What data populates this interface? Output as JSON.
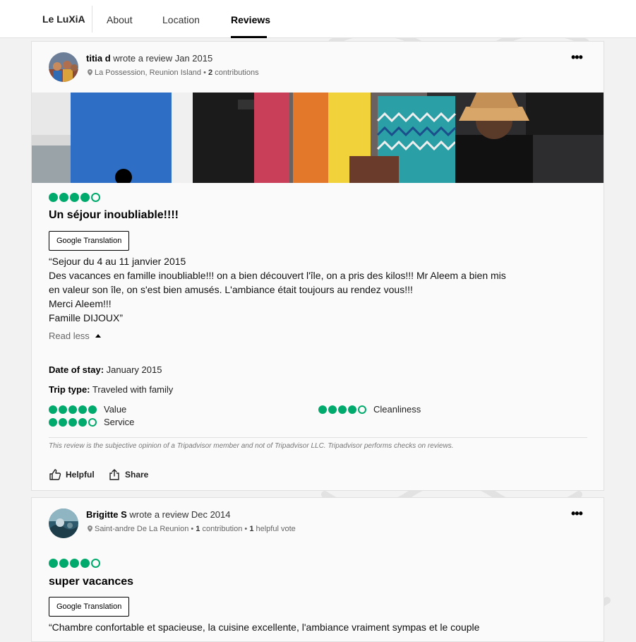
{
  "nav": {
    "brand": "Le LuXiA",
    "tabs": [
      {
        "label": "About"
      },
      {
        "label": "Location"
      },
      {
        "label": "Reviews"
      }
    ]
  },
  "colors": {
    "accent": "#00aa6c"
  },
  "reviews": [
    {
      "author": "titia d",
      "action_text": "wrote a review Jan 2015",
      "location": "La Possession, Reunion Island",
      "separator": " • ",
      "contributions_count": "2",
      "contributions_label": "contributions",
      "more_label": "•••",
      "rating": 4,
      "title": "Un séjour inoubliable!!!!",
      "translate_label": "Google Translation",
      "body_lines": [
        "“Sejour du 4 au 11 janvier 2015",
        "Des vacances en famille inoubliable!!! on a bien découvert l'île, on a pris des kilos!!! Mr Aleem a bien mis",
        "en valeur son île, on s'est bien amusés. L'ambiance était toujours au rendez vous!!!",
        "Merci Aleem!!!",
        "Famille DIJOUX”"
      ],
      "read_less_label": "Read less",
      "date_of_stay_label": "Date of stay:",
      "date_of_stay": "January 2015",
      "trip_type_label": "Trip type:",
      "trip_type": "Traveled with family",
      "sub_ratings": [
        {
          "label": "Value",
          "rating": 5
        },
        {
          "label": "Cleanliness",
          "rating": 4
        },
        {
          "label": "Service",
          "rating": 4
        }
      ],
      "disclaimer": "This review is the subjective opinion of a Tripadvisor member and not of Tripadvisor LLC. Tripadvisor performs checks on reviews.",
      "helpful_label": "Helpful",
      "share_label": "Share"
    },
    {
      "author": "Brigitte S",
      "action_text": "wrote a review Dec 2014",
      "location": "Saint-andre De La Reunion",
      "separator": " • ",
      "contributions_count": "1",
      "contributions_label": "contribution",
      "helpful_votes_count": "1",
      "helpful_votes_label": "helpful vote",
      "more_label": "•••",
      "rating": 4,
      "title": "super vacances",
      "translate_label": "Google Translation",
      "body_lines": [
        "“Chambre confortable et spacieuse, la cuisine excellente, l'ambiance vraiment sympas et le couple"
      ]
    }
  ]
}
